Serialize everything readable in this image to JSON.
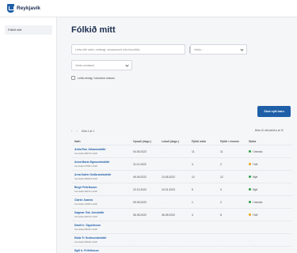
{
  "header": {
    "logo_text": "Reykjavík"
  },
  "sidebar": {
    "items": [
      {
        "label": "Fólkið mitt"
      }
    ]
  },
  "main": {
    "title": "Fólkið mitt",
    "search": {
      "placeholder": "Leita eftir nafni, netfangi, símanúmeri eða kennitölu"
    },
    "filter1": {
      "placeholder": "Veldu..."
    },
    "filter2": {
      "placeholder": "Veldu umdæmi"
    },
    "checkbox_label": "Leita einnig í lokuðum málum",
    "add_button": "Skrá nýtt barn",
    "pager": {
      "text": "Síða 1 af 1",
      "per_page": "Birta 10 niðurstöður af 10"
    },
    "columns": [
      "Nafn",
      "Opnað (dags.)",
      "Lokað (dags.)",
      "Fjöldi mála",
      "Fjöldi í vinnslu",
      "Staða"
    ],
    "rows": [
      {
        "name": "Aníta Rún Jóhannsdóttir",
        "id": "Kennitala 080702-2220",
        "opened": "04.05.2022",
        "closed": "-",
        "count": "11",
        "active": "11",
        "status": "Í vinnslu",
        "status_color": "#2f9e44"
      },
      {
        "name": "Anna María Sigmundsdóttir",
        "id": "Kennitala 070901-3320",
        "opened": "11.01.2022",
        "closed": "-",
        "count": "4",
        "active": "2",
        "status": "Í bið",
        "status_color": "#e8a317"
      },
      {
        "name": "Arna Katrín Guðbrandsdóttir",
        "id": "Kennitala 050903-3220",
        "opened": "09.05.2022",
        "closed": "13.05.2022",
        "count": "12",
        "active": "12",
        "status": "Nýtt",
        "status_color": "#2f9e44"
      },
      {
        "name": "Birgir Friðriksson",
        "id": "Kennitala 030701-2220",
        "opened": "22.10.2022",
        "closed": "24.01.2023",
        "count": "5",
        "active": "3",
        "status": "Nýtt",
        "status_color": "#2f9e44"
      },
      {
        "name": "Clarke Joanna",
        "id": "Kennitala 120901-2220",
        "opened": "09.05.2022",
        "closed": "-",
        "count": "1",
        "active": "2",
        "status": "Í vinnslu",
        "status_color": "#2f9e44"
      },
      {
        "name": "Dagmar Ósk Jónsdóttir",
        "id": "Kennitala 090701-2220",
        "opened": "06.05.2022",
        "closed": "06.05.2022",
        "count": "4",
        "active": "8",
        "status": "Í bið",
        "status_color": "#e8a317"
      },
      {
        "name": "Davíð Þ. Sigurðsson",
        "id": "Kennitala 050301-2220",
        "opened": "-",
        "closed": "-",
        "count": "-",
        "active": "-",
        "status": "-",
        "status_color": ""
      },
      {
        "name": "Edda Ýr Guðmundsdóttir",
        "id": "Kennitala 050301-2220",
        "opened": "-",
        "closed": "-",
        "count": "-",
        "active": "-",
        "status": "-",
        "status_color": ""
      },
      {
        "name": "Egill Þ. Friðriksson",
        "id": "Kennitala 020701-2220",
        "opened": "-",
        "closed": "-",
        "count": "-",
        "active": "-",
        "status": "-",
        "status_color": ""
      }
    ]
  },
  "icons": {
    "search": "search-icon",
    "chevron": "chevron-down-icon",
    "logo": "reykjavik-shield-icon"
  },
  "colors": {
    "primary": "#1f5fa8",
    "title": "#1b2d4f",
    "background": "#f5f6f8"
  }
}
